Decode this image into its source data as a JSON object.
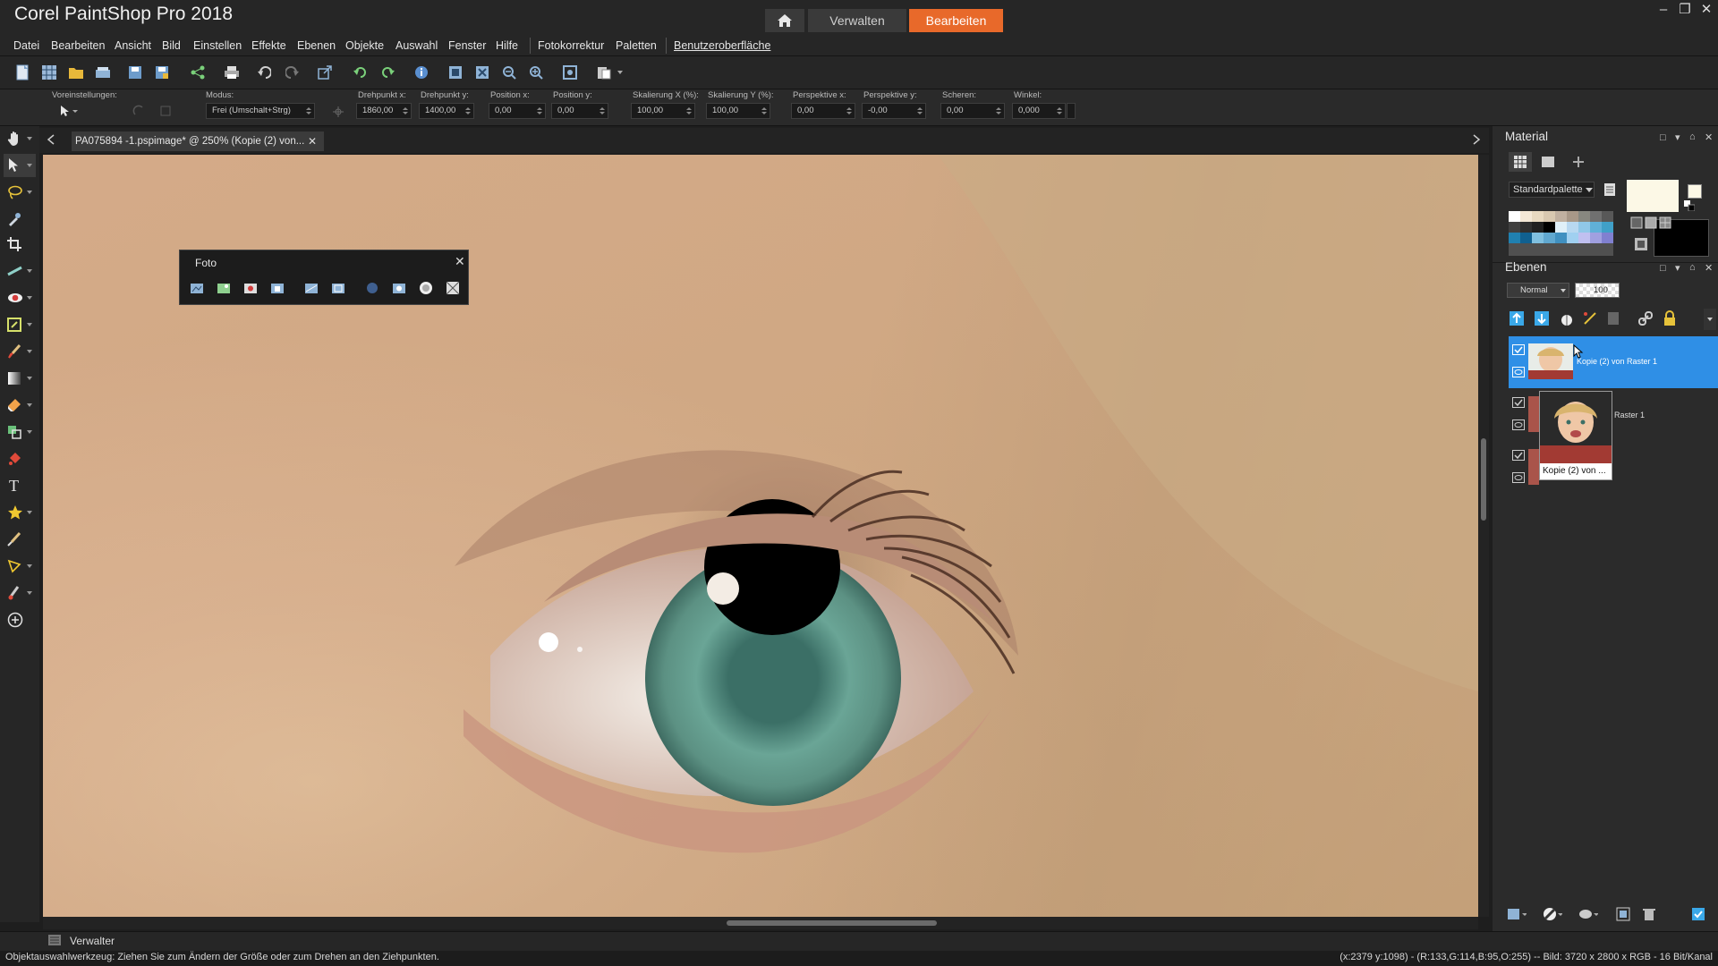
{
  "app": {
    "title": "Corel PaintShop Pro 2018",
    "tabs": [
      "Verwalten",
      "Bearbeiten"
    ]
  },
  "menu": [
    "Datei",
    "Bearbeiten",
    "Ansicht",
    "Bild",
    "Einstellen",
    "Effekte",
    "Ebenen",
    "Objekte",
    "Auswahl",
    "Fenster",
    "Hilfe",
    "Fotokorrektur",
    "Paletten",
    "Benutzeroberfläche"
  ],
  "options": {
    "presets_label": "Voreinstellungen:",
    "mode_label": "Modus:",
    "mode_value": "Frei (Umschalt+Strg)",
    "fields": [
      {
        "label": "Drehpunkt x:",
        "value": "1860,00"
      },
      {
        "label": "Drehpunkt y:",
        "value": "1400,00"
      },
      {
        "label": "Position x:",
        "value": "0,00"
      },
      {
        "label": "Position y:",
        "value": "0,00"
      },
      {
        "label": "Skalierung X (%):",
        "value": "100,00"
      },
      {
        "label": "Skalierung Y (%):",
        "value": "100,00"
      },
      {
        "label": "Perspektive x:",
        "value": "0,00"
      },
      {
        "label": "Perspektive y:",
        "value": "-0,00"
      },
      {
        "label": "Scheren:",
        "value": "0,00"
      },
      {
        "label": "Winkel:",
        "value": "0,000"
      }
    ]
  },
  "document": {
    "tab_label": "PA075894 -1.pspimage* @ 250% (Kopie (2) von..."
  },
  "foto_palette": {
    "title": "Foto"
  },
  "material": {
    "title": "Material",
    "palette_select": "Standardpalette"
  },
  "layers": {
    "title": "Ebenen",
    "blend_mode": "Normal",
    "opacity": "100",
    "items": [
      {
        "name": "Kopie (2) von Raster 1",
        "selected": true
      },
      {
        "name": "Raster 1",
        "selected": false
      },
      {
        "name": "",
        "selected": false
      }
    ],
    "tooltip": "Kopie (2) von ..."
  },
  "bottom": {
    "manager_label": "Verwalter"
  },
  "status": {
    "left": "Objektauswahlwerkzeug: Ziehen Sie zum Ändern der Größe oder zum Drehen an den Ziehpunkten.",
    "right": "(x:2379 y:1098) - (R:133,G:114,B:95,O:255) -- Bild:  3720 x 2800 x RGB - 16 Bit/Kanal"
  },
  "colors": {
    "accent": "#e8692a",
    "selection": "#2f8fe6",
    "iris": "#5f9a8c"
  }
}
